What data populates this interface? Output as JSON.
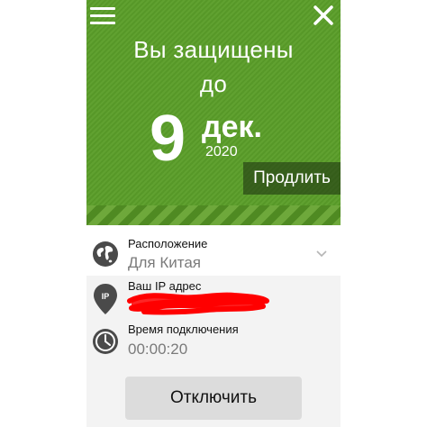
{
  "header": {
    "protected_line1": "Вы защищены",
    "protected_line2": "до",
    "day": "9",
    "month": "дек.",
    "year": "2020",
    "renew_label": "Продлить"
  },
  "location": {
    "label": "Расположение",
    "value": "Для Китая"
  },
  "ip": {
    "label": "Ваш IP адрес"
  },
  "connection_time": {
    "label": "Время подключения",
    "value": "00:00:20"
  },
  "actions": {
    "disconnect_label": "Отключить"
  },
  "colors": {
    "hero_green": "#5a9e29",
    "redaction_red": "#ff0000"
  },
  "icons": {
    "menu": "hamburger-icon",
    "close": "close-icon",
    "location": "globe-icon",
    "ip": "ip-pin-icon",
    "time": "clock-icon",
    "dropdown": "chevron-down-icon"
  }
}
